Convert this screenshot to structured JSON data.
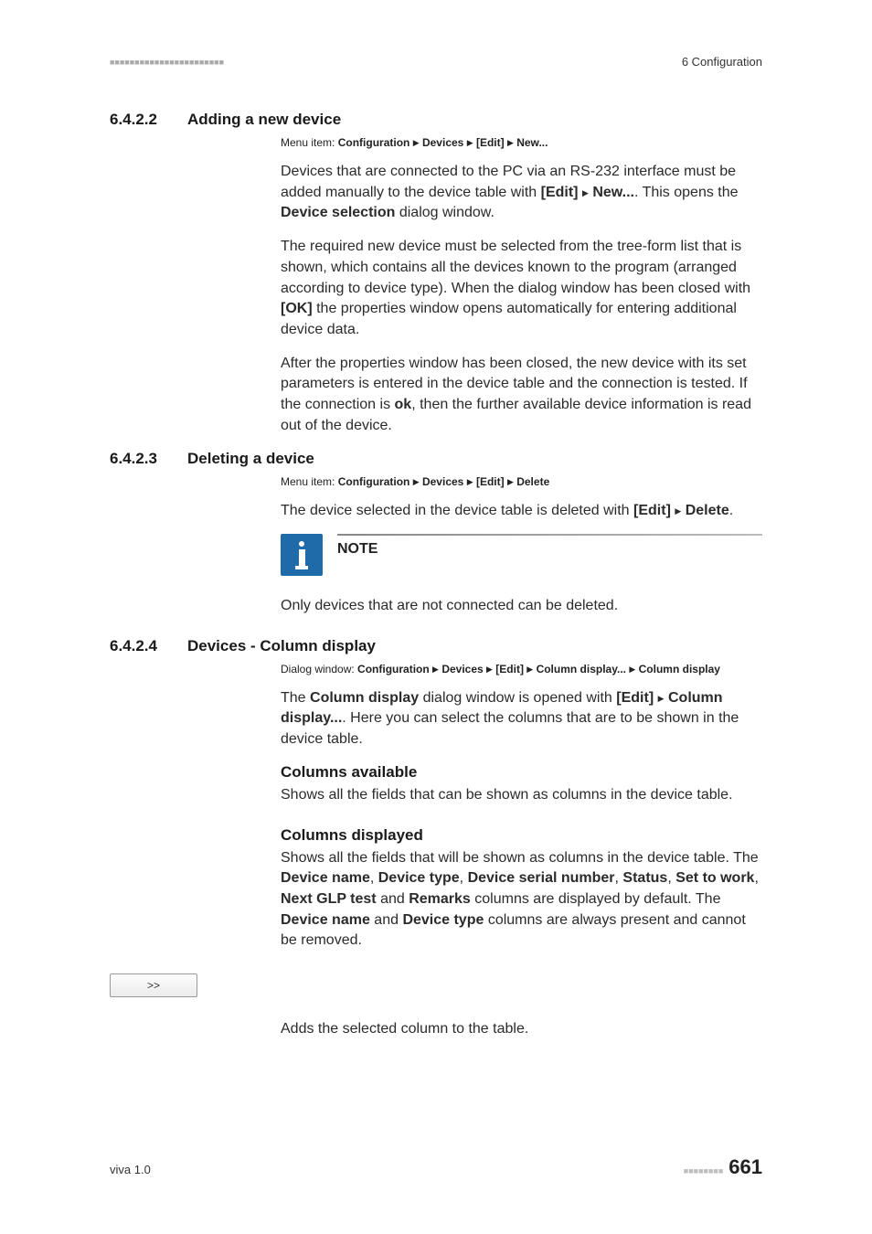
{
  "header": {
    "left_dots": "■■■■■■■■■■■■■■■■■■■■■■■",
    "right": "6 Configuration"
  },
  "sections": {
    "s1": {
      "num": "6.4.2.2",
      "title": "Adding a new device"
    },
    "s2": {
      "num": "6.4.2.3",
      "title": "Deleting a device"
    },
    "s3": {
      "num": "6.4.2.4",
      "title": "Devices - Column display"
    }
  },
  "menu": {
    "s1_prefix": "Menu item: ",
    "s1_a": "Configuration",
    "s1_b": "Devices",
    "s1_c": "[Edit]",
    "s1_d": "New...",
    "s2_prefix": "Menu item: ",
    "s2_a": "Configuration",
    "s2_b": "Devices",
    "s2_c": "[Edit]",
    "s2_d": "Delete",
    "s3_prefix": "Dialog window: ",
    "s3_a": "Configuration",
    "s3_b": "Devices",
    "s3_c": "[Edit]",
    "s3_d": "Column display...",
    "s3_e": "Column display"
  },
  "p": {
    "s1p1_a": "Devices that are connected to the PC via an RS-232 interface must be added manually to the device table with ",
    "s1p1_b": "[Edit]",
    "s1p1_c": "New...",
    "s1p1_d": ". This opens the ",
    "s1p1_e": "Device selection",
    "s1p1_f": " dialog window.",
    "s1p2_a": "The required new device must be selected from the tree-form list that is shown, which contains all the devices known to the program (arranged according to device type). When the dialog window has been closed with ",
    "s1p2_b": "[OK]",
    "s1p2_c": " the properties window opens automatically for entering additional device data.",
    "s1p3_a": "After the properties window has been closed, the new device with its set parameters is entered in the device table and the connection is tested. If the connection is ",
    "s1p3_b": "ok",
    "s1p3_c": ", then the further available device information is read out of the device.",
    "s2p1_a": "The device selected in the device table is deleted with ",
    "s2p1_b": "[Edit]",
    "s2p1_c": "Delete",
    "s2p1_d": ".",
    "note_label": "NOTE",
    "note_text": "Only devices that are not connected can be deleted.",
    "s3p1_a": "The ",
    "s3p1_b": "Column display",
    "s3p1_c": " dialog window is opened with ",
    "s3p1_d": "[Edit]",
    "s3p1_e": "Column display...",
    "s3p1_f": ". Here you can select the columns that are to be shown in the device table.",
    "s3h1": "Columns available",
    "s3p2": "Shows all the fields that can be shown as columns in the device table.",
    "s3h2": "Columns displayed",
    "s3p3_a": "Shows all the fields that will be shown as columns in the device table. The ",
    "s3p3_b": "Device name",
    "s3p3_c": ", ",
    "s3p3_d": "Device type",
    "s3p3_e": ", ",
    "s3p3_f": "Device serial number",
    "s3p3_g": ", ",
    "s3p3_h": "Status",
    "s3p3_i": ", ",
    "s3p3_j": "Set to work",
    "s3p3_k": ", ",
    "s3p3_l": "Next GLP test",
    "s3p3_m": " and ",
    "s3p3_n": "Remarks",
    "s3p3_o": " columns are displayed by default. The ",
    "s3p3_p": "Device name",
    "s3p3_q": " and ",
    "s3p3_r": "Device type",
    "s3p3_s": " columns are always present and cannot be removed.",
    "btn_label": ">>",
    "btn_desc": "Adds the selected column to the table."
  },
  "footer": {
    "left": "viva 1.0",
    "dots": "■■■■■■■■",
    "page": "661"
  }
}
